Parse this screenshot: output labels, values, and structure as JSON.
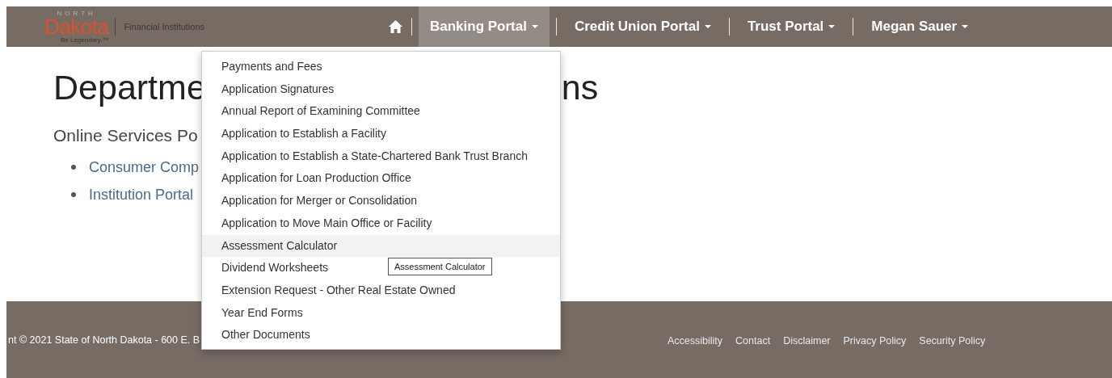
{
  "header": {
    "logo": {
      "top": "NORTH",
      "main": "Dakota",
      "tagline": "Be Legendary.™"
    },
    "site_name": "Financial Institutions"
  },
  "nav": [
    {
      "kind": "home",
      "selected": false
    },
    {
      "kind": "dropdown",
      "label": "Banking Portal",
      "selected": true
    },
    {
      "kind": "dropdown",
      "label": "Credit Union Portal",
      "selected": false
    },
    {
      "kind": "dropdown",
      "label": "Trust Portal",
      "selected": false
    },
    {
      "kind": "dropdown",
      "label": "Megan Sauer",
      "selected": false
    }
  ],
  "page": {
    "heading_parts": [
      "Departme",
      "ns"
    ],
    "subheading": "Online Services Po",
    "links": [
      "Consumer Comp",
      "Institution Portal"
    ]
  },
  "dropdown": {
    "items": [
      {
        "label": "Payments and Fees",
        "selected": false
      },
      {
        "label": "Application Signatures",
        "selected": false
      },
      {
        "label": "Annual Report of Examining Committee",
        "selected": false
      },
      {
        "label": "Application to Establish a Facility",
        "selected": false
      },
      {
        "label": "Application to Establish a State-Chartered Bank Trust Branch",
        "selected": false
      },
      {
        "label": "Application for Loan Production Office",
        "selected": false
      },
      {
        "label": "Application for Merger or Consolidation",
        "selected": false
      },
      {
        "label": "Application to Move Main Office or Facility",
        "selected": false
      },
      {
        "label": "Assessment Calculator",
        "selected": true
      },
      {
        "label": "Dividend Worksheets",
        "selected": false
      },
      {
        "label": "Extension Request - Other Real Estate Owned",
        "selected": false
      },
      {
        "label": "Year End Forms",
        "selected": false
      },
      {
        "label": "Other Documents",
        "selected": false
      }
    ],
    "tooltip": "Assessment Calculator"
  },
  "footer": {
    "copyright": "nt © 2021 State of North Dakota - 600 E. B",
    "links": [
      "Accessibility",
      "Contact",
      "Disclaimer",
      "Privacy Policy",
      "Security Policy"
    ]
  }
}
